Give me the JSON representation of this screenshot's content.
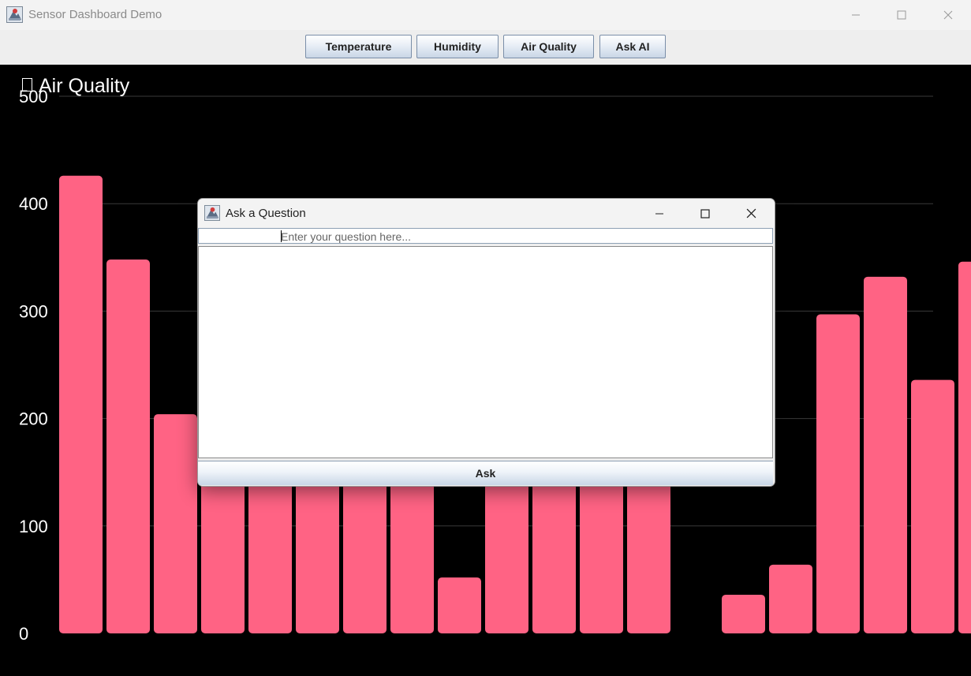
{
  "window": {
    "title": "Sensor Dashboard Demo",
    "minimize_icon": "minimize-icon",
    "maximize_icon": "maximize-icon",
    "close_icon": "close-icon"
  },
  "toolbar": {
    "buttons": [
      {
        "label": "Temperature"
      },
      {
        "label": "Humidity"
      },
      {
        "label": "Air Quality"
      },
      {
        "label": "Ask AI"
      }
    ]
  },
  "chart": {
    "title": "Air Quality",
    "title_glyph": "missing-glyph-box",
    "bar_color": "#ff6384",
    "background": "#000000"
  },
  "chart_data": {
    "type": "bar",
    "title": "Air Quality",
    "xlabel": "",
    "ylabel": "",
    "ylim": [
      0,
      500
    ],
    "yticks": [
      0,
      100,
      200,
      300,
      400,
      500
    ],
    "grid": true,
    "values": [
      426,
      348,
      204,
      140,
      140,
      140,
      140,
      140,
      52,
      140,
      140,
      140,
      140,
      0,
      36,
      64,
      297,
      332,
      236,
      346
    ]
  },
  "dialog": {
    "title": "Ask a Question",
    "input_placeholder": "Enter your question here...",
    "answer_text": "",
    "ask_label": "Ask"
  }
}
